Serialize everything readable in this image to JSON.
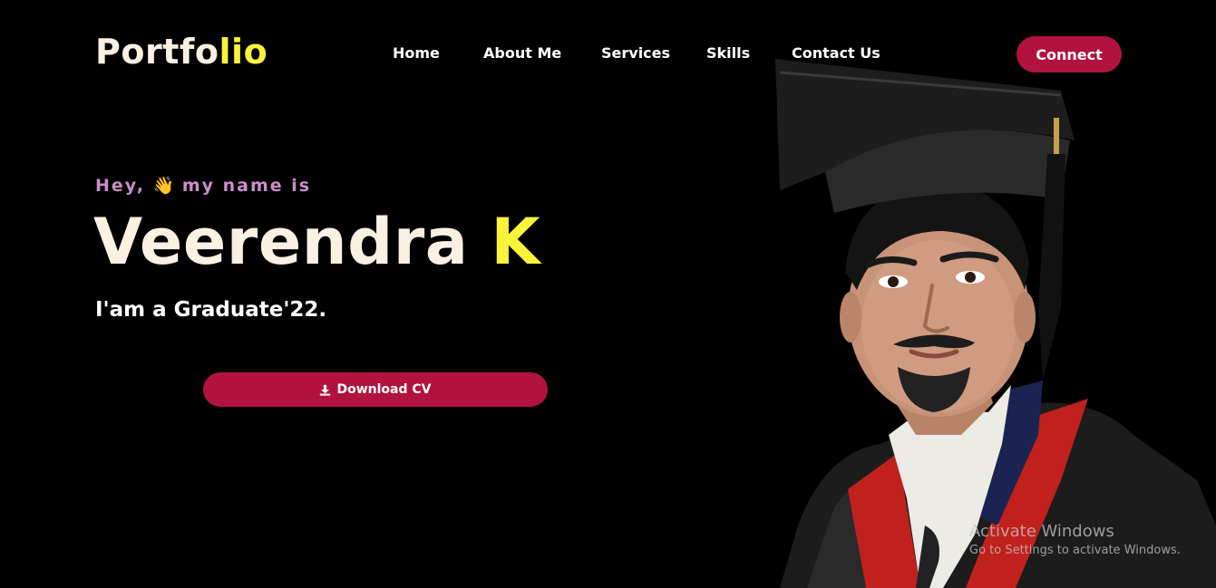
{
  "header": {
    "logo_main": "Portfo",
    "logo_accent": "lio",
    "nav": [
      {
        "label": "Home"
      },
      {
        "label": "About Me"
      },
      {
        "label": "Services"
      },
      {
        "label": "Skills"
      },
      {
        "label": "Contact Us"
      }
    ],
    "connect_label": "Connect"
  },
  "hero": {
    "greeting_pre": "Hey,",
    "greeting_emoji": "👋",
    "greeting_post": "my name is",
    "name_main": "Veerendra",
    "name_accent": "K",
    "tagline": "I'am a Graduate'22.",
    "download_label": "Download CV",
    "download_icon": "download-icon"
  },
  "portrait": {
    "icon": "graduate-portrait"
  },
  "watermark": {
    "title": "Activate Windows",
    "subtitle": "Go to Settings to activate Windows."
  },
  "colors": {
    "background": "#000000",
    "accent_yellow": "#f8f33b",
    "accent_crimson": "#b2133e",
    "greeting_purple": "#c98fc9",
    "text_cream": "#faf1e3"
  }
}
